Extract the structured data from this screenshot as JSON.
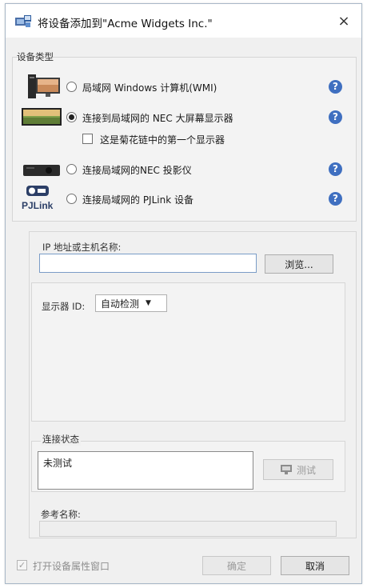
{
  "dialog": {
    "title": "将设备添加到\"Acme Widgets Inc.\"",
    "close": "×"
  },
  "device_type": {
    "group_label": "设备类型",
    "options": [
      {
        "label": "局域网 Windows 计算机(WMI)",
        "checked": false,
        "icon": "windows-computer-icon"
      },
      {
        "label": "连接到局域网的 NEC 大屏幕显示器",
        "checked": true,
        "icon": "large-display-icon"
      },
      {
        "label": "连接局域网的NEC 投影仪",
        "checked": false,
        "icon": "projector-icon"
      },
      {
        "label": "连接局域网的 PJLink 设备",
        "checked": false,
        "icon": "pjlink-icon"
      }
    ],
    "daisy_chain_label": "这是菊花链中的第一个显示器",
    "help_glyph": "?",
    "pjlink_logo_text": "PJLink"
  },
  "connection": {
    "ip_label": "IP 地址或主机名称:",
    "ip_value": "",
    "browse_label": "浏览...",
    "monitor_id_label": "显示器 ID:",
    "monitor_id_value": "自动检测",
    "status_group_label": "连接状态",
    "status_text": "未测试",
    "test_label": "测试",
    "ref_name_label": "参考名称:",
    "ref_name_value": ""
  },
  "footer": {
    "open_props_label": "打开设备属性窗口",
    "ok_label": "确定",
    "cancel_label": "取消"
  }
}
